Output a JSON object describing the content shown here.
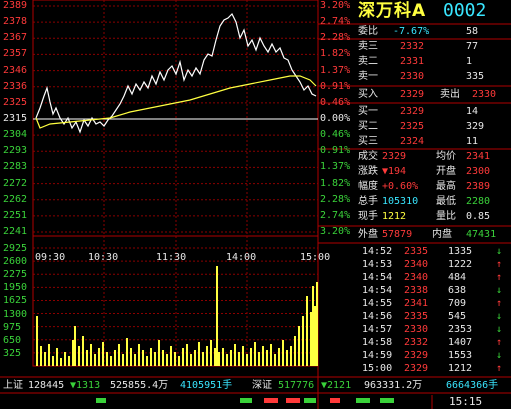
{
  "stock": {
    "name": "深万科A",
    "code": "0002"
  },
  "price_axis": {
    "left": [
      "2389",
      "2378",
      "2367",
      "2357",
      "2346",
      "2336",
      "2325",
      "2315",
      "2304",
      "2293",
      "2283",
      "2272",
      "2262",
      "2251",
      "2241"
    ],
    "right": [
      "3.20%",
      "2.74%",
      "2.28%",
      "1.82%",
      "1.37%",
      "0.91%",
      "0.46%",
      "0.00%",
      "0.46%",
      "0.91%",
      "1.37%",
      "1.82%",
      "2.28%",
      "2.74%",
      "3.20%"
    ]
  },
  "vol_axis": [
    "2925",
    "2600",
    "2275",
    "1950",
    "1625",
    "1300",
    "975",
    "650",
    "325"
  ],
  "time_axis": [
    "09:30",
    "10:30",
    "11:30",
    "14:00",
    "15:00"
  ],
  "colors": {
    "up": "#ff3a3a",
    "down": "#3ad23a",
    "price_line": "#ffffff",
    "avg_line": "#ffff40",
    "grid": "#8b0000"
  },
  "quote": {
    "wei_bi_label": "委比",
    "wei_bi_value": "-7.67%",
    "wei_cha": "58",
    "sell": [
      {
        "label": "卖三",
        "price": "2332",
        "volume": "77"
      },
      {
        "label": "卖二",
        "price": "2331",
        "volume": "1"
      },
      {
        "label": "卖一",
        "price": "2330",
        "volume": "335"
      }
    ],
    "buy_in": {
      "label": "买入",
      "price": "2329",
      "mid": "卖出",
      "price2": "2330"
    },
    "buy": [
      {
        "label": "买一",
        "price": "2329",
        "volume": "14"
      },
      {
        "label": "买二",
        "price": "2325",
        "volume": "329"
      },
      {
        "label": "买三",
        "price": "2324",
        "volume": "11"
      }
    ],
    "stats": [
      {
        "l1": "成交",
        "v1": "2329",
        "l2": "均价",
        "v2": "2341"
      },
      {
        "l1": "涨跌",
        "v1": "▼194",
        "l2": "开盘",
        "v2": "2300"
      },
      {
        "l1": "幅度",
        "v1": "+0.60%",
        "l2": "最高",
        "v2": "2389"
      },
      {
        "l1": "总手",
        "v1": "105310",
        "l2": "最低",
        "v2": "2280"
      },
      {
        "l1": "现手",
        "v1": "1212",
        "l2": "量比",
        "v2": "0.85"
      }
    ],
    "outer_label": "外盘",
    "outer_value": "57879",
    "inner_label": "内盘",
    "inner_value": "47431"
  },
  "trades": [
    {
      "time": "14:52",
      "price": "2335",
      "vol": "1335",
      "dir": "↓"
    },
    {
      "time": "14:53",
      "price": "2340",
      "vol": "1222",
      "dir": "↑"
    },
    {
      "time": "14:54",
      "price": "2340",
      "vol": "484",
      "dir": "↑"
    },
    {
      "time": "14:54",
      "price": "2338",
      "vol": "638",
      "dir": "↓"
    },
    {
      "time": "14:55",
      "price": "2341",
      "vol": "709",
      "dir": "↑"
    },
    {
      "time": "14:56",
      "price": "2335",
      "vol": "545",
      "dir": "↓"
    },
    {
      "time": "14:57",
      "price": "2330",
      "vol": "2353",
      "dir": "↓"
    },
    {
      "time": "14:58",
      "price": "2332",
      "vol": "1407",
      "dir": "↑"
    },
    {
      "time": "14:59",
      "price": "2329",
      "vol": "1553",
      "dir": "↓"
    },
    {
      "time": "15:00",
      "price": "2329",
      "vol": "1212",
      "dir": "↑"
    }
  ],
  "ticker": {
    "sh_label": "上证",
    "sh_index": "128445",
    "sh_change": "▼1313",
    "sh_amount": "525855.4万",
    "sh_vol": "4105951手",
    "sz_label": "深证",
    "sz_index": "517776",
    "sz_change": "▼2121",
    "sz_amount": "963331.2万",
    "sz_vol": "6664366手"
  },
  "status": {
    "clock": "15:15"
  },
  "chart_data": {
    "type": "line",
    "x": [
      "09:30",
      "10:30",
      "11:30",
      "14:00",
      "15:00"
    ],
    "prev_close": 2315,
    "ylim": [
      2241,
      2389
    ],
    "series": [],
    "volume_ylim": [
      0,
      2925
    ]
  }
}
